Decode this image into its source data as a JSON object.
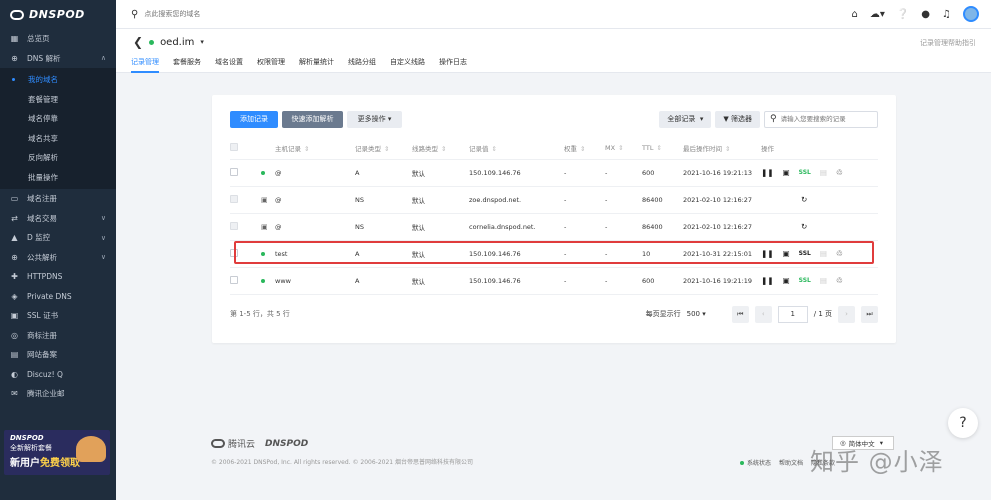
{
  "brand": {
    "name": "DNSPOD"
  },
  "topbar": {
    "search_placeholder": "点此搜索您的域名"
  },
  "sidebar": {
    "items": [
      {
        "label": "总览页",
        "icon": "grid-icon"
      },
      {
        "label": "DNS 解析",
        "icon": "globe-icon",
        "expanded": true
      },
      {
        "label": "我的域名",
        "active": true,
        "sub": true
      },
      {
        "label": "套餐管理",
        "sub": true
      },
      {
        "label": "域名停靠",
        "sub": true
      },
      {
        "label": "域名共享",
        "sub": true
      },
      {
        "label": "反向解析",
        "sub": true
      },
      {
        "label": "批量操作",
        "sub": true
      },
      {
        "label": "域名注册",
        "icon": "card-icon"
      },
      {
        "label": "域名交易",
        "icon": "trade-icon",
        "chevron": true
      },
      {
        "label": "D 监控",
        "icon": "monitor-icon",
        "chevron": true
      },
      {
        "label": "公共解析",
        "icon": "globe-icon",
        "chevron": true
      },
      {
        "label": "HTTPDNS",
        "icon": "cross-icon"
      },
      {
        "label": "Private DNS",
        "icon": "shield-icon"
      },
      {
        "label": "SSL 证书",
        "icon": "lock-icon"
      },
      {
        "label": "商标注册",
        "icon": "badge-icon"
      },
      {
        "label": "网站备案",
        "icon": "doc-icon"
      },
      {
        "label": "Discuz! Q",
        "icon": "chat-icon"
      },
      {
        "label": "腾讯企业邮",
        "icon": "mail-icon"
      }
    ],
    "promo": {
      "brand": "DNSPOD",
      "line1": "全新解析套餐",
      "line2_prefix": "新用户",
      "line2_highlight": "免费领取"
    }
  },
  "subhead": {
    "domain": "oed.im",
    "help_link": "记录管理帮助指引",
    "tabs": [
      "记录管理",
      "套餐服务",
      "域名设置",
      "权限管理",
      "解析量统计",
      "线路分组",
      "自定义线路",
      "操作日志"
    ],
    "active_tab": 0
  },
  "toolbar": {
    "add_record": "添加记录",
    "quick_add": "快速添加解析",
    "more_ops": "更多操作",
    "all_records": "全部记录",
    "filter": "筛选器",
    "search_placeholder": "请输入您要搜索的记录"
  },
  "table": {
    "headers": [
      "主机记录",
      "记录类型",
      "线路类型",
      "记录值",
      "权重",
      "MX",
      "TTL",
      "最后操作时间",
      "操作"
    ],
    "rows": [
      {
        "host": "@",
        "type": "A",
        "line": "默认",
        "value": "150.109.146.76",
        "weight": "-",
        "mx": "-",
        "ttl": "600",
        "time": "2021-10-16 19:21:13",
        "status": "green-dot",
        "ops": "full"
      },
      {
        "host": "@",
        "type": "NS",
        "line": "默认",
        "value": "zoe.dnspod.net.",
        "weight": "-",
        "mx": "-",
        "ttl": "86400",
        "time": "2021-02-10 12:16:27",
        "status": "monitor",
        "ops": "refresh"
      },
      {
        "host": "@",
        "type": "NS",
        "line": "默认",
        "value": "cornelia.dnspod.net.",
        "weight": "-",
        "mx": "-",
        "ttl": "86400",
        "time": "2021-02-10 12:16:27",
        "status": "monitor",
        "ops": "refresh"
      },
      {
        "host": "test",
        "type": "A",
        "line": "默认",
        "value": "150.109.146.76",
        "weight": "-",
        "mx": "-",
        "ttl": "10",
        "time": "2021-10-31 22:15:01",
        "status": "green-dot",
        "ops": "full",
        "highlight": true
      },
      {
        "host": "www",
        "type": "A",
        "line": "默认",
        "value": "150.109.146.76",
        "weight": "-",
        "mx": "-",
        "ttl": "600",
        "time": "2021-10-16 19:21:19",
        "status": "green-dot",
        "ops": "full"
      }
    ],
    "ssl_label": "SSL"
  },
  "pager": {
    "summary": "第 1-5 行，共 5 行",
    "page_size_label": "每页显示行",
    "page_size": "500",
    "current_page": "1",
    "total_pages": "/ 1 页"
  },
  "footer": {
    "logo_tencent": "腾讯云",
    "logo_dnspod": "DNSPOD",
    "copyright": "© 2006-2021 DNSPod, Inc. All rights reserved. © 2006-2021 烟台帝思普网络科技有限公司",
    "status": "系统状态",
    "help": "帮助文档",
    "privacy": "隐私条款",
    "lang": "简体中文"
  },
  "watermark": "知乎 @小泽",
  "colors": {
    "accent": "#2f8cff",
    "sidebar_bg": "#1f2d3d",
    "highlight_border": "#e03c3c",
    "status_green": "#2ab85c"
  }
}
